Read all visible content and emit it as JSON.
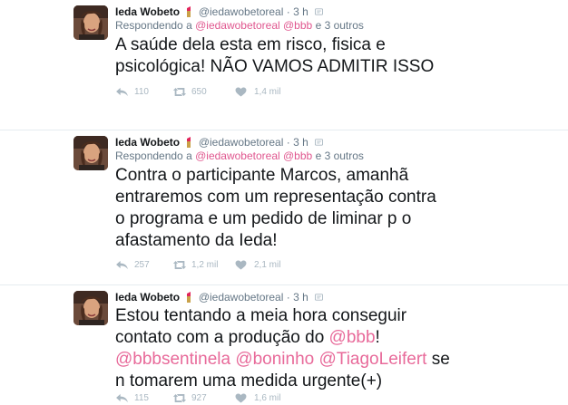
{
  "colors": {
    "name": "#14171a",
    "meta": "#657786",
    "link": "#e0578f",
    "mention": "#e86a9a",
    "action": "#aab8c2",
    "divider": "#e6ecf0"
  },
  "tweets": [
    {
      "name": "Ieda Wobeto",
      "handle": "@iedawobetoreal",
      "dot": "·",
      "time": "3 h",
      "reply_prefix": "Respondendo a",
      "reply_links": "@iedawobetoreal @bbb",
      "reply_suffix": "e 3 outros",
      "text_plain": "A saúde dela esta em risco, fisica e\npsicológica! NÃO VAMOS ADMITIR ISSO",
      "replies": "110",
      "retweets": "650",
      "likes": "1,4 mil"
    },
    {
      "name": "Ieda Wobeto",
      "handle": "@iedawobetoreal",
      "dot": "·",
      "time": "3 h",
      "reply_prefix": "Respondendo a",
      "reply_links": "@iedawobetoreal @bbb",
      "reply_suffix": "e 3 outros",
      "text_plain": "Contra o participante Marcos, amanhã\nentraremos com um representação contra\no programa e um pedido de liminar p o\nafastamento da Ieda!",
      "replies": "257",
      "retweets": "1,2 mil",
      "likes": "2,1 mil"
    },
    {
      "name": "Ieda Wobeto",
      "handle": "@iedawobetoreal",
      "dot": "·",
      "time": "3 h",
      "text_part1": "Estou tentando a meia hora conseguir\ncontato com a produção do ",
      "mention_bbb": "@bbb",
      "text_part2": "!\n",
      "mention_line": "@bbbsentinela @boninho @TiagoLeifert",
      "text_part3": " se\nn tomarem uma medida urgente(+)",
      "replies": "115",
      "retweets": "927",
      "likes": "1,6 mil"
    }
  ],
  "icons": {
    "reply": "reply-icon",
    "retweet": "retweet-icon",
    "like": "heart-icon",
    "verified_badge": "lipstick-icon",
    "bird": "bird-icon"
  }
}
